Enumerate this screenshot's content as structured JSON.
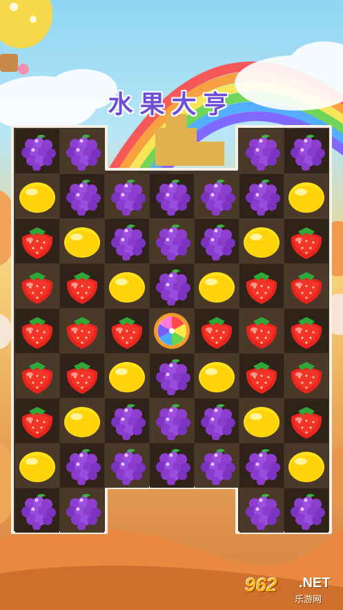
{
  "game": {
    "title": "水果大亨",
    "colors": {
      "board": "#3a2a1e",
      "cell_dark": "#2f2219",
      "cell_light": "#4a3828",
      "border": "#f4f0e6"
    },
    "board": {
      "columns": 7,
      "rows": 9,
      "grid": [
        [
          "grape",
          "grape",
          null,
          null,
          null,
          "grape",
          "grape"
        ],
        [
          "lemon",
          "grape",
          "grape",
          "grape",
          "grape",
          "grape",
          "lemon"
        ],
        [
          "strawberry",
          "lemon",
          "grape",
          "grape",
          "grape",
          "lemon",
          "strawberry"
        ],
        [
          "strawberry",
          "strawberry",
          "lemon",
          "grape",
          "lemon",
          "strawberry",
          "strawberry"
        ],
        [
          "strawberry",
          "strawberry",
          "strawberry",
          "rainbow-candy",
          "strawberry",
          "strawberry",
          "strawberry"
        ],
        [
          "strawberry",
          "strawberry",
          "lemon",
          "grape",
          "lemon",
          "strawberry",
          "strawberry"
        ],
        [
          "strawberry",
          "lemon",
          "grape",
          "grape",
          "grape",
          "lemon",
          "strawberry"
        ],
        [
          "lemon",
          "grape",
          "grape",
          "grape",
          "grape",
          "grape",
          "lemon"
        ],
        [
          "grape",
          "grape",
          null,
          null,
          null,
          "grape",
          "grape"
        ]
      ]
    }
  },
  "watermark": {
    "number": "962",
    "domain": ".NET",
    "site": "乐游网"
  }
}
